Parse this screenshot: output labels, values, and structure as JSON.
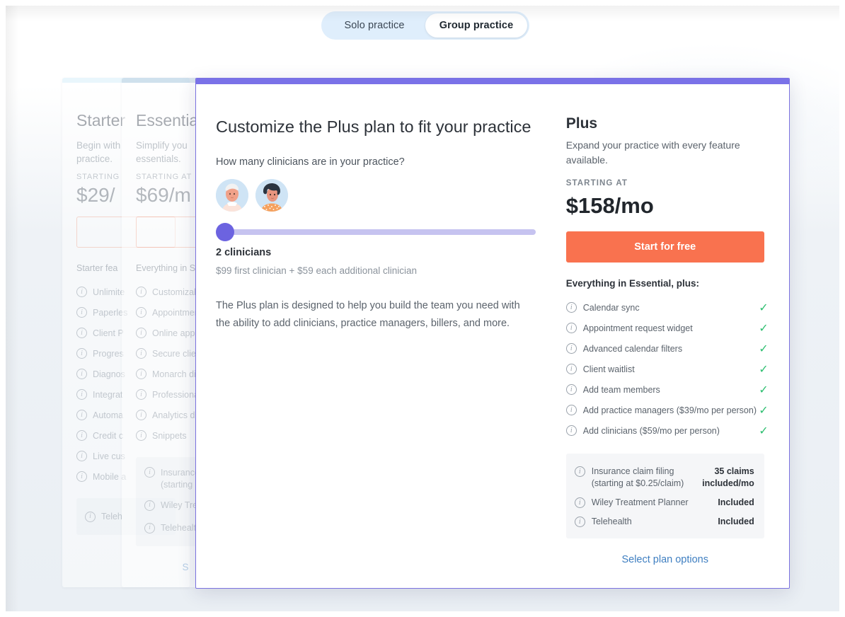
{
  "toggle": {
    "options": [
      {
        "label": "Solo practice",
        "active": false
      },
      {
        "label": "Group practice",
        "active": true
      }
    ]
  },
  "background_cards": [
    {
      "accent_color": "#d6eefb",
      "title": "Starter",
      "subtitle": "Begin with\npractice.",
      "starting_label": "STARTING",
      "price": "$29/",
      "everything": "Starter fea",
      "features": [
        "Unlimite",
        "Paperles",
        "Client P",
        "Progres",
        "Diagnos",
        "Integrat",
        "Automa",
        "Credit c",
        "Live cus",
        "Mobile a"
      ],
      "box_features": [
        {
          "label": "Teleh",
          "sub": ""
        }
      ],
      "link": ""
    },
    {
      "accent_color": "#b9cfe0",
      "title": "Essential",
      "subtitle": "Simplify you\nessentials.",
      "starting_label": "STARTING AT",
      "price": "$69/m",
      "everything": "Everything in S",
      "features": [
        "Customizab",
        "Appointmen",
        "Online appo",
        "Secure clien",
        "Monarch dir",
        "Professional",
        "Analytics da",
        "Snippets"
      ],
      "box_features": [
        {
          "label": "Insurance",
          "sub": "(starting a"
        },
        {
          "label": "Wiley Tre",
          "sub": ""
        },
        {
          "label": "Telehealth",
          "sub": ""
        }
      ],
      "link": "S"
    }
  ],
  "modal": {
    "accent_color": "#7a72e8",
    "left": {
      "title": "Customize the Plus plan to fit your practice",
      "question": "How many clinicians are in your practice?",
      "avatars": [
        "avatar-clinician-1",
        "avatar-clinician-2"
      ],
      "slider": {
        "value": "2",
        "min": "1",
        "max": "40",
        "percent": 0
      },
      "clinician_count": "2 clinicians",
      "pricing_note": "$99 first clinician + $59 each additional clinician",
      "description": "The Plus plan is designed to help you build the team you need with the ability to add clinicians, practice managers, billers, and more."
    },
    "right": {
      "plan_name": "Plus",
      "plan_subtitle": "Expand your practice with every feature available.",
      "starting_label": "STARTING AT",
      "price": "$158/mo",
      "cta_label": "Start for free",
      "cta_color": "#f9724f",
      "everything_label": "Everything in Essential, plus:",
      "check_color": "#2fbf71",
      "features": [
        {
          "label": "Calendar sync",
          "included": true
        },
        {
          "label": "Appointment request widget",
          "included": true
        },
        {
          "label": "Advanced calendar filters",
          "included": true
        },
        {
          "label": "Client waitlist",
          "included": true
        },
        {
          "label": "Add team members",
          "included": true
        },
        {
          "label": "Add practice managers ($39/mo per person)",
          "included": true
        },
        {
          "label": "Add clinicians ($59/mo per person)",
          "included": true
        }
      ],
      "addons": [
        {
          "label": "Insurance claim filing\n(starting at $0.25/claim)",
          "value": "35 claims\nincluded/mo"
        },
        {
          "label": "Wiley Treatment Planner",
          "value": "Included"
        },
        {
          "label": "Telehealth",
          "value": "Included"
        }
      ],
      "link_label": "Select plan options"
    }
  }
}
